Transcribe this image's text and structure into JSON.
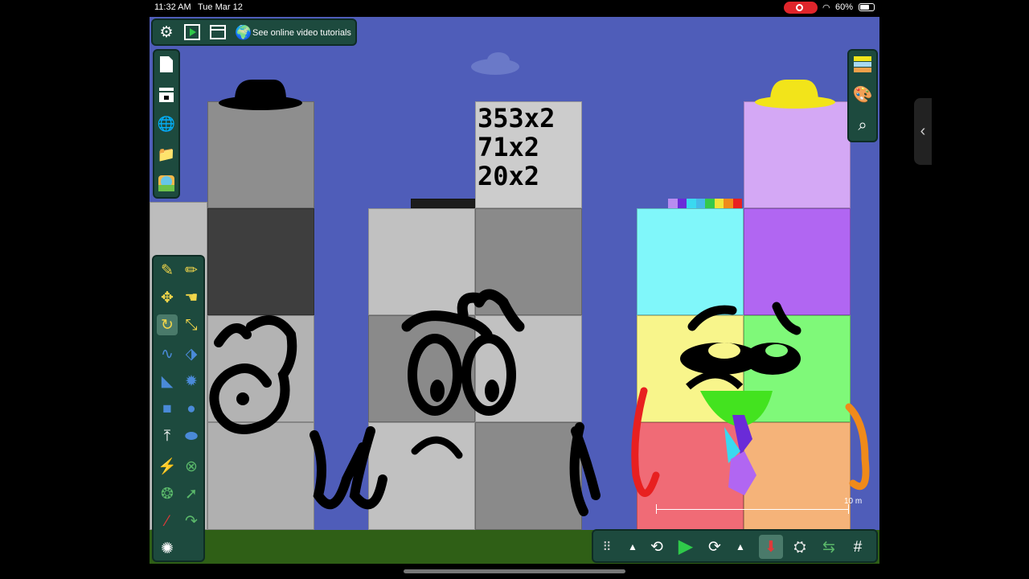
{
  "status_bar": {
    "time": "11:32 AM",
    "date": "Tue Mar 12",
    "battery": "60%"
  },
  "top_toolbar": {
    "tutorial_link": "See online video tutorials"
  },
  "canvas": {
    "whiteboard_lines": [
      "353x2",
      "71x2",
      "20x2"
    ],
    "scale_label": "10 m"
  },
  "icons": {
    "settings": "gear-icon",
    "play_mode": "play-icon",
    "window": "window-icon",
    "globe": "globe-icon",
    "new_file": "file-icon",
    "storage": "box-icon",
    "load_web": "download-globe-icon",
    "open_folder": "folder-icon",
    "gallery": "gallery-icon",
    "layers": "layers-icon",
    "palette": "palette-icon",
    "zoom_search": "magnifier-icon"
  }
}
